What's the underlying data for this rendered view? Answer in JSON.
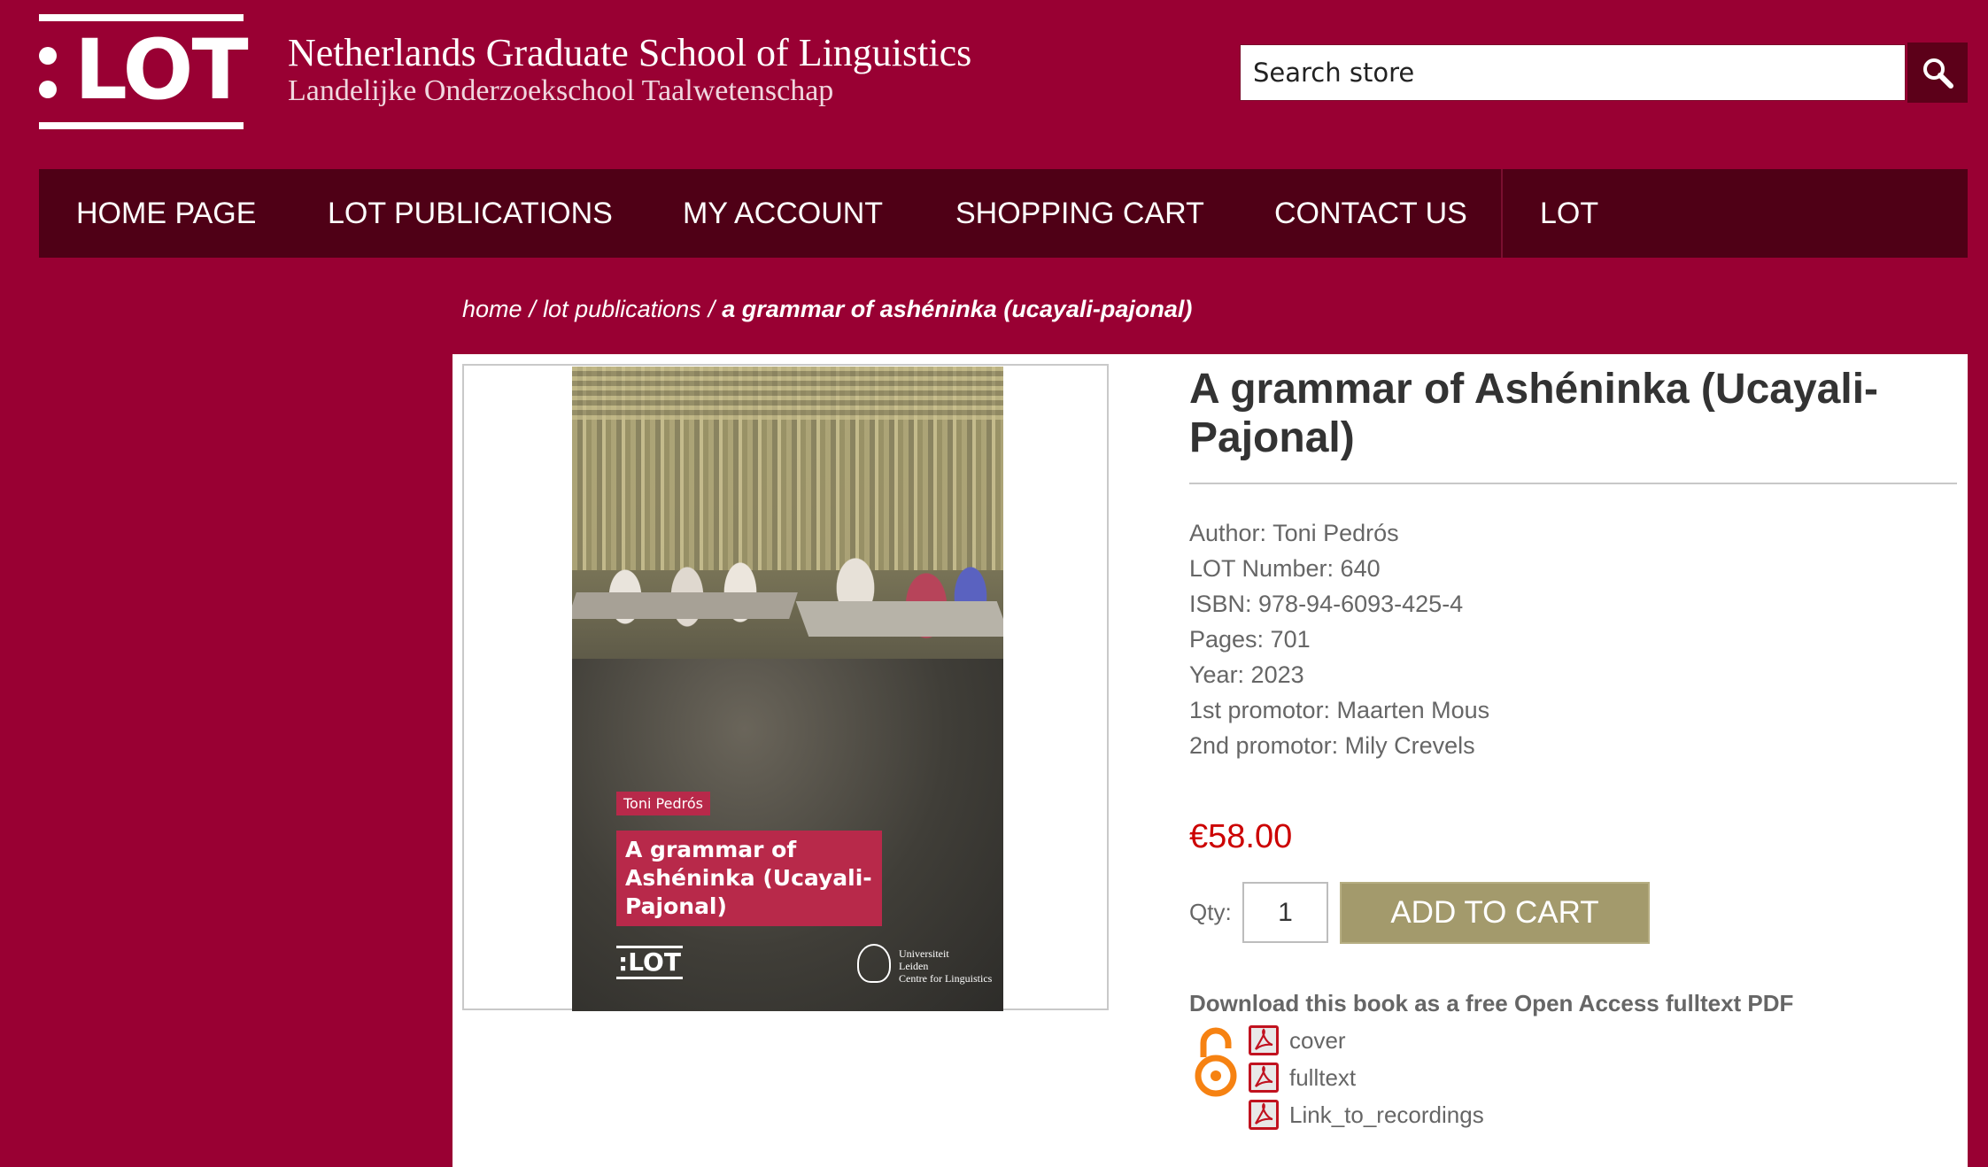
{
  "brand": {
    "logo_text": ":LOT",
    "title": "Netherlands Graduate School of Linguistics",
    "subtitle": "Landelijke Onderzoekschool Taalwetenschap"
  },
  "search": {
    "placeholder": "Search store"
  },
  "nav": {
    "items": [
      {
        "label": "Home page"
      },
      {
        "label": "LOT Publications"
      },
      {
        "label": "My account"
      },
      {
        "label": "Shopping cart"
      },
      {
        "label": "Contact us"
      },
      {
        "label": "LOT"
      }
    ]
  },
  "breadcrumb": {
    "items": [
      "home",
      "lot publications"
    ],
    "separator": "/",
    "current": "a grammar of ashéninka (ucayali-pajonal)"
  },
  "cover": {
    "author": "Toni Pedrós",
    "title": "A grammar of Ashéninka (Ucayali-Pajonal)",
    "logo": ":LOT",
    "university": [
      "Universiteit",
      "Leiden",
      "Centre for Linguistics"
    ]
  },
  "product": {
    "title": "A grammar of Ashéninka (Ucayali-Pajonal)",
    "specs": [
      "Author: Toni Pedrós",
      "LOT Number: 640",
      "ISBN: 978-94-6093-425-4",
      "Pages: 701",
      "Year: 2023",
      "1st promotor: Maarten Mous",
      "2nd promotor: Mily Crevels"
    ],
    "price": "€58.00",
    "qty_label": "Qty:",
    "qty_value": "1",
    "add_to_cart": "Add to cart"
  },
  "downloads": {
    "heading": "Download this book as a free Open Access fulltext PDF",
    "files": [
      "cover",
      "fulltext",
      "Link_to_recordings"
    ]
  },
  "colors": {
    "background": "#990033",
    "nav": "#4f0016",
    "search_button": "#5c0019",
    "price": "#cc0000",
    "cart_button": "#a39a6c",
    "open_access": "#f68212"
  }
}
